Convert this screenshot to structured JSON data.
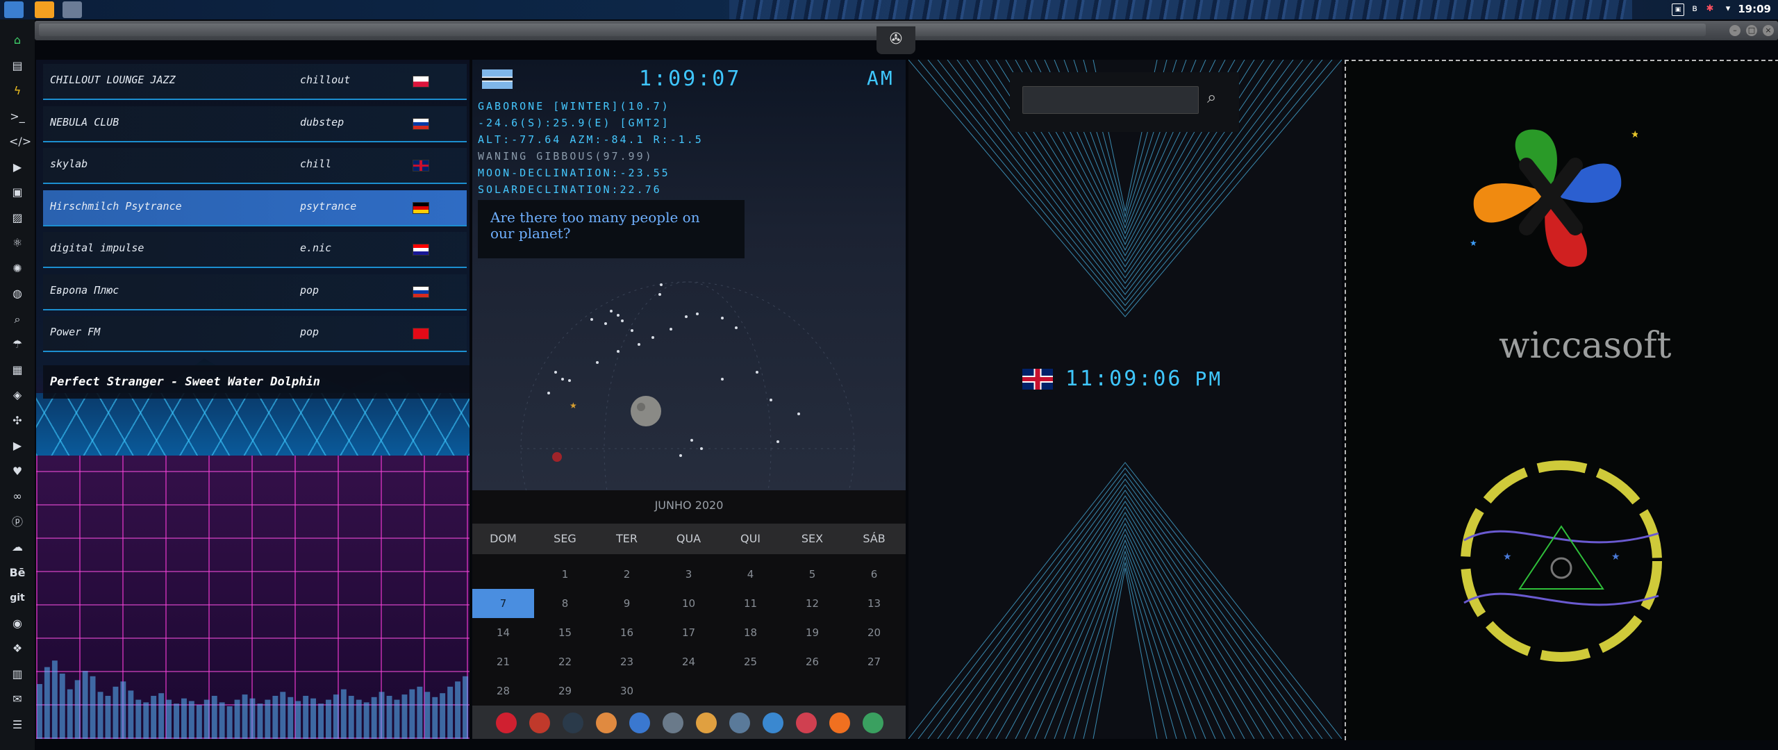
{
  "taskbar": {
    "clock": "19:09",
    "tray_icons": [
      "photo-icon",
      "bluetooth-icon",
      "bug-icon",
      "wifi-icon"
    ],
    "apps": [
      "file-manager-icon",
      "sublime-icon",
      "app-icon"
    ]
  },
  "window": {
    "controls": [
      "minimize",
      "maximize",
      "close"
    ],
    "badge_icon": "rebel-alliance-icon"
  },
  "dock": {
    "items": [
      "home-icon",
      "document-icon",
      "bolt-icon",
      "terminal-icon",
      "code-icon",
      "play-icon",
      "media-icon",
      "image-icon",
      "atom-icon",
      "react-icon",
      "globe-icon",
      "search-icon",
      "umbrella-icon",
      "contact-icon",
      "tag-icon",
      "grid-icon",
      "youtube-icon",
      "heart-icon",
      "infinity-icon",
      "pinterest-icon",
      "cloud-icon",
      "behance-icon",
      "git-icon",
      "github-icon",
      "layers-icon",
      "map-icon",
      "mail-icon",
      "server-icon"
    ],
    "text_items": {
      "behance": "Bē",
      "git": "git"
    }
  },
  "radio": {
    "stations": [
      {
        "name": "CHILLOUT LOUNGE JAZZ",
        "genre": "chillout",
        "flag": "PL",
        "selected": false
      },
      {
        "name": "NEBULA CLUB",
        "genre": "dubstep",
        "flag": "RU",
        "selected": false
      },
      {
        "name": "skylab",
        "genre": "chill",
        "flag": "GB",
        "selected": false
      },
      {
        "name": "Hirschmilch Psytrance",
        "genre": "psytrance",
        "flag": "DE",
        "selected": true
      },
      {
        "name": "digital impulse",
        "genre": "e.nic",
        "flag": "HR",
        "selected": false
      },
      {
        "name": "Европа Плюс",
        "genre": "pop",
        "flag": "RU",
        "selected": false
      },
      {
        "name": "Power FM",
        "genre": "pop",
        "flag": "TR",
        "selected": false
      }
    ],
    "now_playing": "Perfect Stranger - Sweet Water Dolphin",
    "spectrum_levels": [
      0.42,
      0.55,
      0.6,
      0.5,
      0.38,
      0.45,
      0.52,
      0.48,
      0.36,
      0.33,
      0.4,
      0.44,
      0.37,
      0.3,
      0.28,
      0.33,
      0.35,
      0.3,
      0.27,
      0.31,
      0.29,
      0.26,
      0.3,
      0.33,
      0.28,
      0.25,
      0.3,
      0.34,
      0.31,
      0.27,
      0.3,
      0.33,
      0.36,
      0.32,
      0.29,
      0.33,
      0.31,
      0.27,
      0.3,
      0.34,
      0.38,
      0.33,
      0.3,
      0.28,
      0.32,
      0.36,
      0.33,
      0.3,
      0.34,
      0.38,
      0.4,
      0.36,
      0.32,
      0.35,
      0.4,
      0.44,
      0.48
    ]
  },
  "astro": {
    "time": "1:09:07",
    "ampm": "AM",
    "lines": [
      "GABORONE [WINTER](10.7)",
      "-24.6(S):25.9(E) [GMT2]",
      "ALT:-77.64 AZM:-84.1 R:-1.5",
      "WANING GIBBOUS(97.99)",
      "MOON-DECLINATION:-23.55",
      "SOLARDECLINATION:22.76"
    ],
    "quote": "Are there too many people on our planet?",
    "flag": "BW"
  },
  "calendar": {
    "month": "JUNHO 2020",
    "weekdays": [
      "DOM",
      "SEG",
      "TER",
      "QUA",
      "QUI",
      "SEX",
      "SÁB"
    ],
    "first_weekday": 1,
    "days": 30,
    "today": 7
  },
  "appbar": {
    "icons": [
      "arch-icon",
      "hourglass-icon",
      "earth-icon",
      "image-viewer-icon",
      "translate-icon",
      "news-icon",
      "magnifier-icon",
      "clock-icon",
      "globe-icon",
      "calendar-icon",
      "terminal-arrow-icon",
      "yandex-icon"
    ]
  },
  "world_clock": {
    "time": "11:09:06",
    "ampm": "PM",
    "flag": "GB"
  },
  "search": {
    "placeholder": ""
  },
  "brand": {
    "name": "wiccasoft"
  },
  "colors": {
    "lcd": "#3fc7ff",
    "selected_row": "#2f6cc4",
    "today": "#4a8ee0"
  }
}
